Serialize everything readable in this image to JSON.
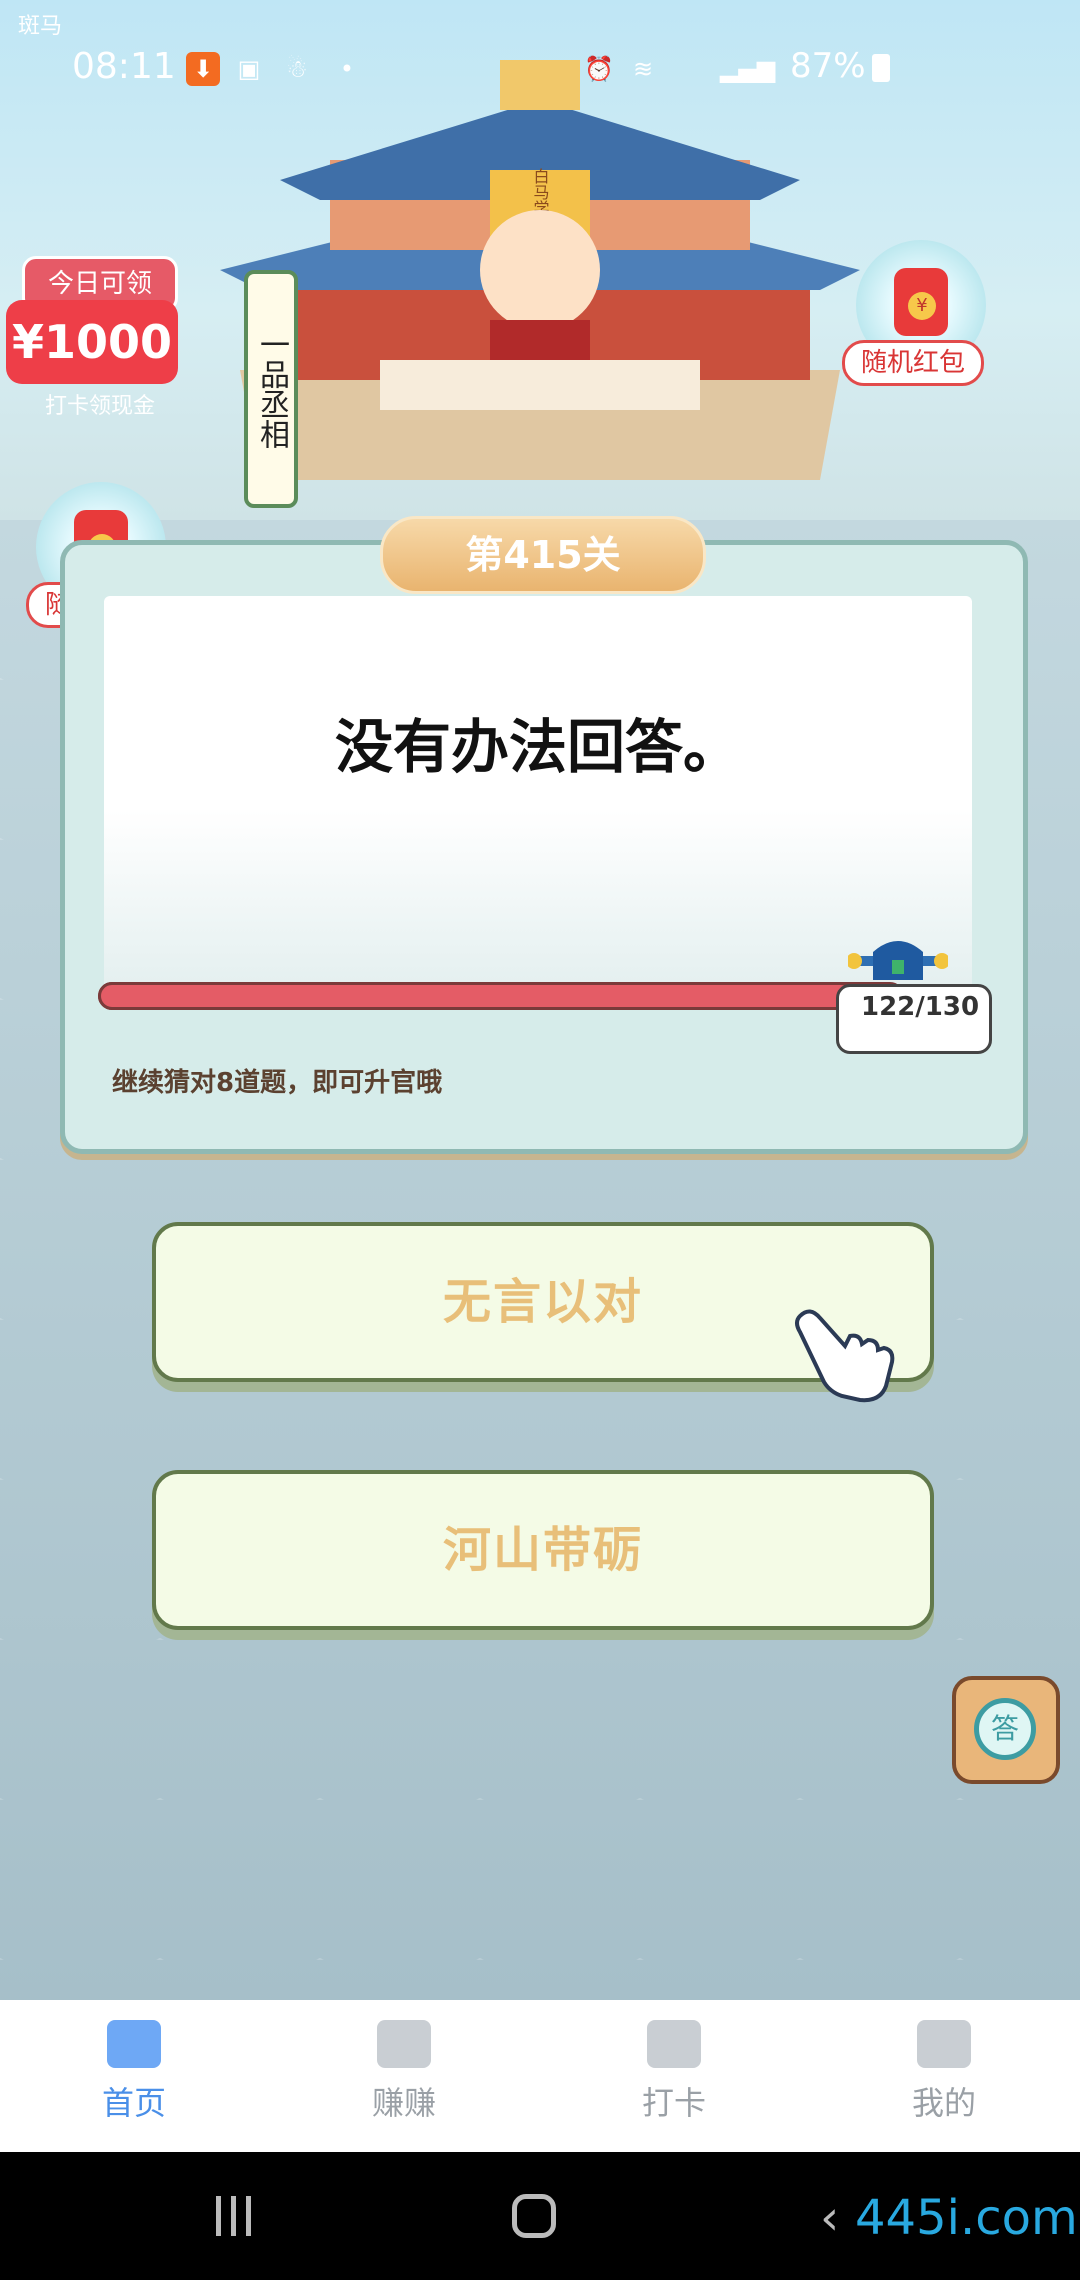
{
  "status_bar": {
    "corner_text": "斑马",
    "time": "08:11",
    "battery": "87%"
  },
  "promo": {
    "today_label": "今日可领",
    "today_amount": "¥1000",
    "today_sub": "打卡领现金"
  },
  "rank_title": "一品丞相",
  "palace_sign": "白马学堂",
  "red_packet_label": "随机红包",
  "level": "第415关",
  "question": "没有办法回答。",
  "progress": {
    "current": 122,
    "total": 130,
    "label": "122/130"
  },
  "hint": "继续猜对8道题，即可升官哦",
  "answers": [
    "无言以对",
    "河山带砺"
  ],
  "lookup_icon_text": "答",
  "nav": {
    "items": [
      {
        "label": "首页",
        "icon": "home-icon",
        "active": true
      },
      {
        "label": "赚赚",
        "icon": "gift-icon",
        "active": false
      },
      {
        "label": "打卡",
        "icon": "calendar-check-icon",
        "active": false
      },
      {
        "label": "我的",
        "icon": "wallet-icon",
        "active": false
      }
    ]
  },
  "watermark": "445i.com",
  "colors": {
    "accent_red": "#ee3e48",
    "nav_active": "#4a8fe8",
    "answer_text": "#e8bf79"
  }
}
